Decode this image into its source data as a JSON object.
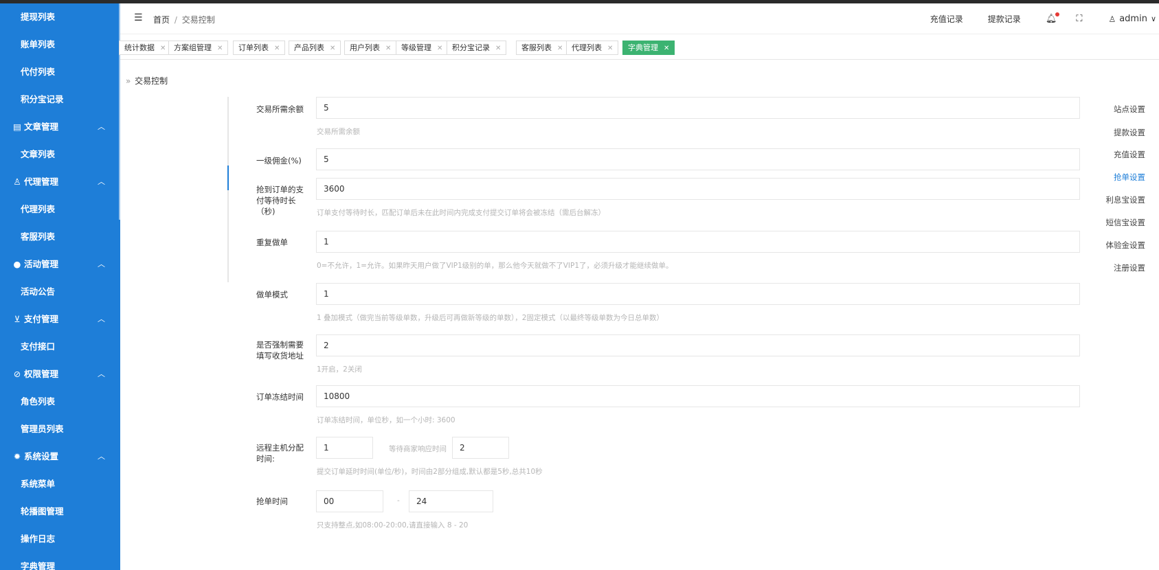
{
  "sidebar": {
    "items": [
      {
        "label": "提现列表",
        "kind": "child"
      },
      {
        "label": "账单列表",
        "kind": "child"
      },
      {
        "label": "代付列表",
        "kind": "child"
      },
      {
        "label": "积分宝记录",
        "kind": "child"
      },
      {
        "label": "文章管理",
        "kind": "group",
        "icon": "document-icon",
        "glyph": "▤"
      },
      {
        "label": "文章列表",
        "kind": "child"
      },
      {
        "label": "代理管理",
        "kind": "group",
        "icon": "user-icon",
        "glyph": "♙"
      },
      {
        "label": "代理列表",
        "kind": "child"
      },
      {
        "label": "客服列表",
        "kind": "child"
      },
      {
        "label": "活动管理",
        "kind": "group",
        "icon": "circle-icon",
        "glyph": "●"
      },
      {
        "label": "活动公告",
        "kind": "child"
      },
      {
        "label": "支付管理",
        "kind": "group",
        "icon": "cart-icon",
        "glyph": "⊻"
      },
      {
        "label": "支付接口",
        "kind": "child"
      },
      {
        "label": "权限管理",
        "kind": "group",
        "icon": "shield-check-icon",
        "glyph": "⊘"
      },
      {
        "label": "角色列表",
        "kind": "child"
      },
      {
        "label": "管理员列表",
        "kind": "child"
      },
      {
        "label": "系统设置",
        "kind": "group",
        "icon": "gear-icon",
        "glyph": "✹"
      },
      {
        "label": "系统菜单",
        "kind": "child"
      },
      {
        "label": "轮播图管理",
        "kind": "child"
      },
      {
        "label": "操作日志",
        "kind": "child"
      },
      {
        "label": "字典管理",
        "kind": "child"
      }
    ]
  },
  "header": {
    "breadcrumb_home": "首页",
    "breadcrumb_sep": "/",
    "breadcrumb_current": "交易控制",
    "recharge_link": "充值记录",
    "withdraw_link": "提款记录",
    "username": "admin"
  },
  "tabs": [
    {
      "label": "统计数据",
      "active": false
    },
    {
      "label": "方案组管理",
      "active": false
    },
    {
      "label": "订单列表",
      "active": false
    },
    {
      "label": "产品列表",
      "active": false
    },
    {
      "label": "用户列表",
      "active": false
    },
    {
      "label": "等级管理",
      "active": false
    },
    {
      "label": "积分宝记录",
      "active": false
    },
    {
      "label": "客服列表",
      "active": false
    },
    {
      "label": "代理列表",
      "active": false
    },
    {
      "label": "字典管理",
      "active": true
    }
  ],
  "page": {
    "title": "交易控制"
  },
  "subnav": {
    "items": [
      "站点设置",
      "提款设置",
      "充值设置",
      "抢单设置",
      "利息宝设置",
      "短信宝设置",
      "体验金设置",
      "注册设置"
    ],
    "active_index": 3
  },
  "form": {
    "balance": {
      "label": "交易所需余额",
      "value": "5",
      "hint": "交易所需余额"
    },
    "commission": {
      "label": "一级佣金(%)",
      "value": "5"
    },
    "pay_wait": {
      "label": "抢到订单的支付等待时长（秒)",
      "value": "3600",
      "hint": "订单支付等待时长，匹配订单后未在此时间内完成支付提交订单将会被冻结（需后台解冻）"
    },
    "repeat": {
      "label": "重复做单",
      "value": "1",
      "hint": "0=不允许，1=允许。如果昨天用户做了VIP1级别的单，那么他今天就做不了VIP1了，必须升级才能继续做单。"
    },
    "mode": {
      "label": "做单模式",
      "value": "1",
      "hint": "1 叠加模式（做完当前等级单数，升级后可再做新等级的单数），2固定模式（以最终等级单数为今日总单数）"
    },
    "force_address": {
      "label": "是否强制需要填写收货地址",
      "value": "2",
      "hint": "1开启，2关闭"
    },
    "freeze_time": {
      "label": "订单冻结时间",
      "value": "10800",
      "hint": "订单冻结时间，单位秒，如一个小时: 3600"
    },
    "remote": {
      "label": "远程主机分配时间:",
      "value": "1",
      "wait_label": "等待商家响应时间",
      "wait_value": "2",
      "hint": "提交订单延时时间(单位/秒)，时间由2部分组成,默认都是5秒,总共10秒"
    },
    "grab_time": {
      "label": "抢单时间",
      "start": "00",
      "dash": "-",
      "end": "24",
      "hint": "只支持整点,如08:00-20:00,请直接输入 8 - 20"
    }
  }
}
